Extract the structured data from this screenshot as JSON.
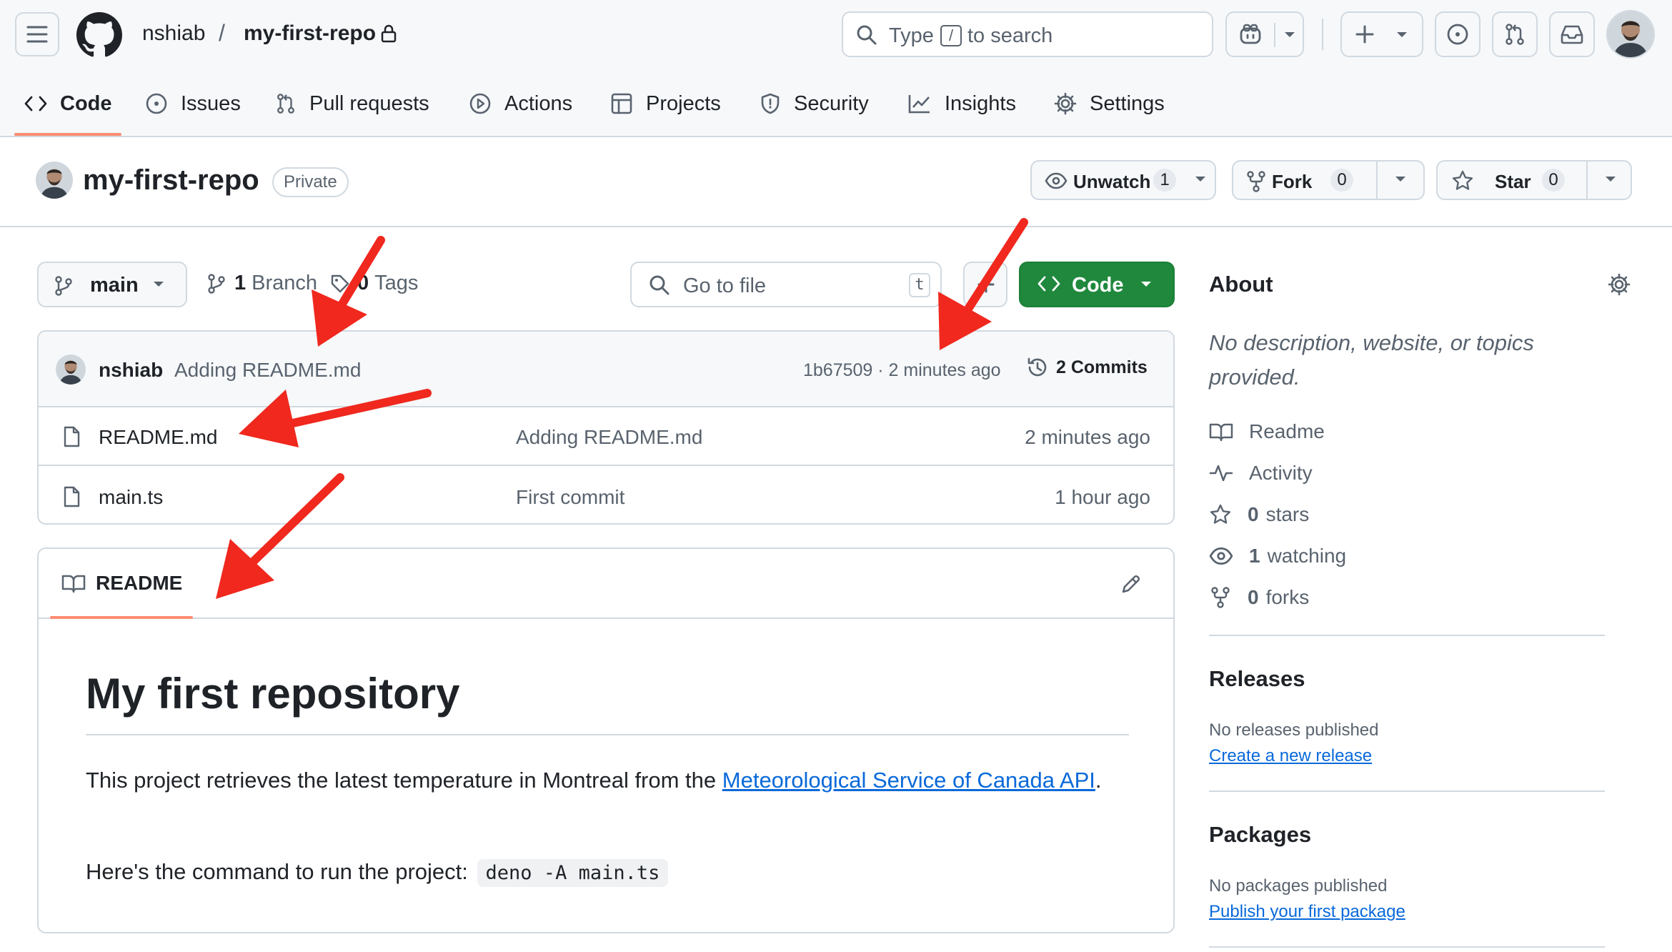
{
  "header": {
    "owner": "nshiab",
    "separator": "/",
    "repo": "my-first-repo",
    "search": {
      "prefix": "Type",
      "key": "/",
      "suffix": "to search"
    }
  },
  "nav": {
    "tabs": [
      {
        "label": "Code",
        "icon": "code-icon"
      },
      {
        "label": "Issues",
        "icon": "issue-opened-icon"
      },
      {
        "label": "Pull requests",
        "icon": "git-pull-request-icon"
      },
      {
        "label": "Actions",
        "icon": "play-icon"
      },
      {
        "label": "Projects",
        "icon": "table-icon"
      },
      {
        "label": "Security",
        "icon": "shield-icon"
      },
      {
        "label": "Insights",
        "icon": "graph-icon"
      },
      {
        "label": "Settings",
        "icon": "gear-icon"
      }
    ]
  },
  "repo_header": {
    "name": "my-first-repo",
    "visibility": "Private",
    "watch": {
      "label": "Unwatch",
      "count": "1"
    },
    "fork": {
      "label": "Fork",
      "count": "0"
    },
    "star": {
      "label": "Star",
      "count": "0"
    }
  },
  "toolbar": {
    "branch": "main",
    "branches": {
      "count": "1",
      "label": "Branch"
    },
    "tags": {
      "count": "0",
      "label": "Tags"
    },
    "goto_placeholder": "Go to file",
    "goto_key": "t",
    "code_label": "Code"
  },
  "latest_commit": {
    "author": "nshiab",
    "message": "Adding README.md",
    "meta": "1b67509 · 2 minutes ago",
    "commits": "2 Commits"
  },
  "files": [
    {
      "name": "README.md",
      "message": "Adding README.md",
      "age": "2 minutes ago"
    },
    {
      "name": "main.ts",
      "message": "First commit",
      "age": "1 hour ago"
    }
  ],
  "readme": {
    "tab_label": "README",
    "heading": "My first repository",
    "p1_before": "This project retrieves the latest temperature in Montreal from the ",
    "p1_link": "Meteorological Service of Canada API",
    "p1_after": ".",
    "p2_text": "Here's the command to run the project:",
    "p2_code": "deno -A main.ts"
  },
  "sidebar": {
    "about_title": "About",
    "about_desc": "No description, website, or topics provided.",
    "items": [
      {
        "icon": "book-icon",
        "strong": "",
        "label": "Readme"
      },
      {
        "icon": "pulse-icon",
        "strong": "",
        "label": "Activity"
      },
      {
        "icon": "star-icon",
        "strong": "0",
        "label": "stars"
      },
      {
        "icon": "eye-icon",
        "strong": "1",
        "label": "watching"
      },
      {
        "icon": "repo-forked-icon",
        "strong": "0",
        "label": "forks"
      }
    ],
    "releases": {
      "title": "Releases",
      "note": "No releases published",
      "link": "Create a new release"
    },
    "packages": {
      "title": "Packages",
      "note": "No packages published",
      "link": "Publish your first package"
    }
  },
  "colors": {
    "accent_underline": "#fd8c73",
    "primary_button": "#1f883d",
    "link": "#0969da",
    "annotation_arrow": "#f0281e"
  }
}
